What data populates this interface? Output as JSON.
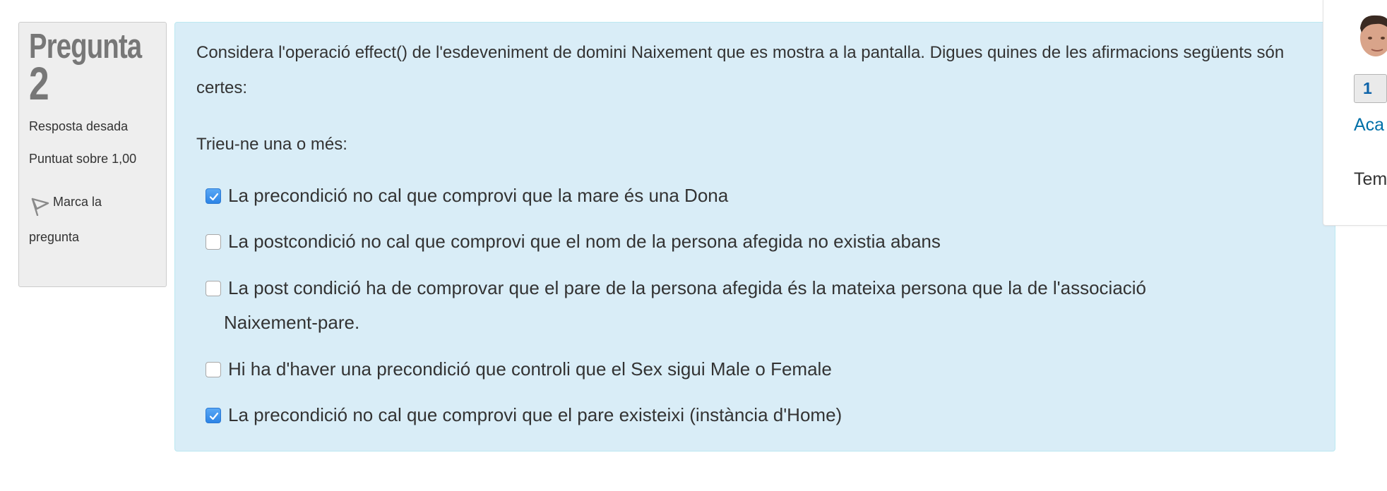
{
  "info": {
    "title_word": "Pregunta",
    "number": "2",
    "state": "Resposta desada",
    "grade": "Puntuat sobre 1,00",
    "flag_label_1": "Marca la",
    "flag_label_2": "pregunta",
    "flag_icon": "flag-icon"
  },
  "question": {
    "text": "Considera l'operació effect() de l'esdeveniment de domini Naixement que es mostra a la pantalla. Digues quines de les afirmacions següents són certes:",
    "prompt": "Trieu-ne una o més:",
    "options": [
      {
        "label": "La precondició no cal que comprovi que la mare és una Dona",
        "checked": true
      },
      {
        "label": "La postcondició no cal que comprovi que el nom de la persona afegida no existia abans",
        "checked": false
      },
      {
        "label": "La post condició ha de comprovar que el pare de la persona afegida és la mateixa persona que la de l'associació",
        "label_cont": "Naixement-pare.",
        "checked": false
      },
      {
        "label": "Hi ha d'haver una precondició que controli que el Sex sigui Male o Female",
        "checked": false
      },
      {
        "label": "La precondició no cal que comprovi que el pare existeixi (instància d'Home)",
        "checked": true
      }
    ]
  },
  "nav": {
    "button": "1",
    "finish_link": "Aca",
    "time_label": "Tem"
  },
  "colors": {
    "content_bg": "#d9edf7",
    "info_bg": "#eeeeee",
    "link": "#0070a8",
    "check": "#2c84e6"
  }
}
